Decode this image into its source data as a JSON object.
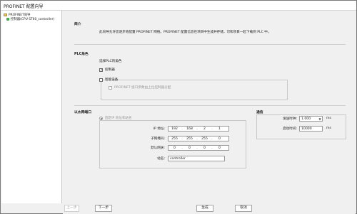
{
  "window": {
    "title": "PROFINET 配置向导"
  },
  "tree": {
    "root_label": "PROFINET向导",
    "child_label": "控制器(CPU ST60_controller)"
  },
  "intro": {
    "title": "简介",
    "text": "此向导允许您逐步地配置 PROFINET 网络。PROFINET 配置信息在项目中生成并存储，可和项目一起下载到 PLC 中。"
  },
  "plc_role": {
    "title": "PLC角色",
    "subtitle": "选择PLC的角色",
    "controller_label": "控制器",
    "controller_checked": true,
    "idevice_label": "智能设备",
    "idevice_checked": false,
    "port_label": "PROFINET 接口参数由上位控制器分配",
    "port_checked": false
  },
  "ethernet": {
    "title": "以太网端口",
    "fixed_ip_label": "固定IP 地址和站名",
    "ip_label": "IP 地址:",
    "ip": [
      "192",
      "168",
      "2",
      "1"
    ],
    "subnet_label": "子网掩码:",
    "subnet": [
      "255",
      "255",
      "255",
      "0"
    ],
    "gateway_label": "默认网关:",
    "gateway": [
      "0",
      "0",
      "0",
      "0"
    ],
    "station_label": "站名:",
    "station_value": "controller"
  },
  "communication": {
    "title": "通信",
    "send_clock_label": "发送时钟:",
    "send_clock_value": "1.000",
    "send_clock_unit": "ms",
    "startup_label": "启动时间:",
    "startup_value": "10000",
    "startup_unit": "ms"
  },
  "buttons": {
    "prev": "上一步",
    "next": "下一步",
    "generate": "生成",
    "cancel": "取消"
  }
}
